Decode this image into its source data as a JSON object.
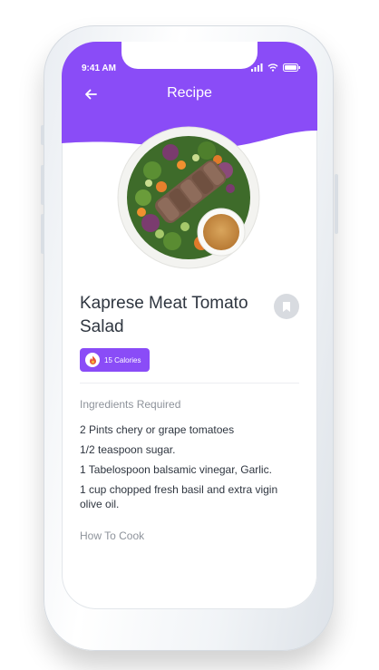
{
  "status_bar": {
    "time": "9:41 AM"
  },
  "header": {
    "title": "Recipe",
    "back_icon": "arrow-left-icon",
    "background_color": "#8a4cf7"
  },
  "recipe": {
    "title": "Kaprese Meat Tomato Salad",
    "calories_label": "15 Calories",
    "calories_icon": "flame-icon",
    "bookmark_icon": "bookmark-icon"
  },
  "ingredients_section": {
    "title": "Ingredients Required",
    "items": [
      "2 Pints chery or grape tomatoes",
      "1/2 teaspoon sugar.",
      "1 Tabelospoon balsamic vinegar, Garlic.",
      "1 cup chopped fresh basil and extra vigin olive oil."
    ]
  },
  "how_to_cook_section": {
    "title": "How To Cook"
  },
  "colors": {
    "accent": "#8a4cf7",
    "text_primary": "#2f3640",
    "text_muted": "#8e939b"
  }
}
